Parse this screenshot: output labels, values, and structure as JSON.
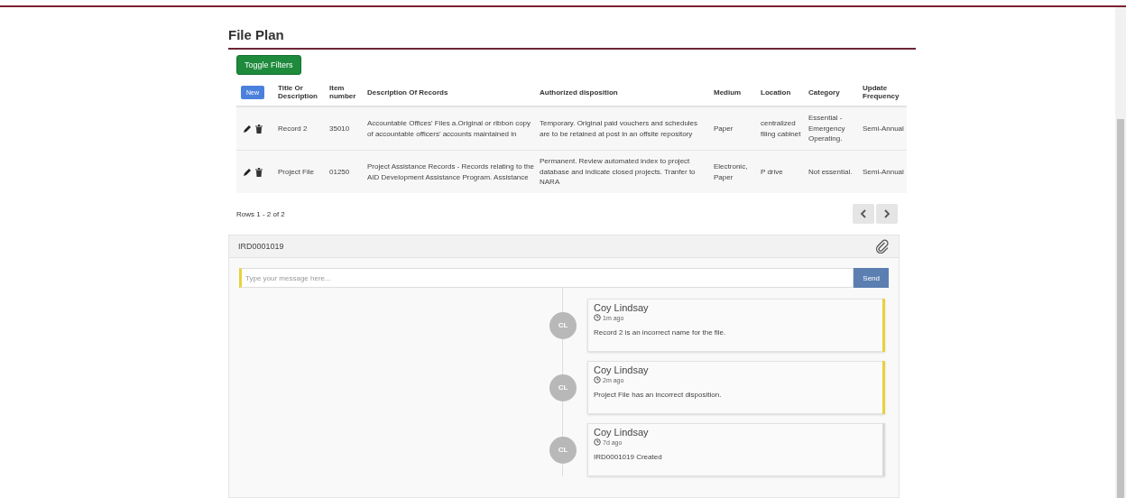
{
  "page": {
    "title": "File Plan"
  },
  "toolbar": {
    "toggle_filters": "Toggle Filters"
  },
  "table": {
    "new_button": "New",
    "columns": [
      "Title Or Description",
      "Item number",
      "Description Of Records",
      "Authorized disposition",
      "Medium",
      "Location",
      "Category",
      "Update Frequency"
    ],
    "rows": [
      {
        "cells": [
          "Record 2",
          "35010",
          "Accountable Offices' Files a.Original or ribbon copy of accountable officers' accounts maintained in",
          "Temporary. Original paid vouchers and schedules are to be retained at post in an offsite repository",
          "Paper",
          "centralized filing cabinet",
          "Essential - Emergency Operating.",
          "Semi-Annual"
        ]
      },
      {
        "cells": [
          "Project File",
          "01250",
          "Project Assistance Records - Records relating to the AID Development Assistance Program. Assistance",
          "Permanent. Review automated index to project database and indicate closed projects. Tranfer to NARA",
          "Electronic, Paper",
          "P drive",
          "Not essential.",
          "Semi-Annual"
        ]
      }
    ],
    "row_count": "Rows 1 - 2 of 2"
  },
  "comments_panel": {
    "title": "IRD0001019",
    "input": {
      "placeholder": "Type your message here..."
    },
    "send_button": "Send",
    "comments": [
      {
        "initials": "CL",
        "author": "Coy Lindsay",
        "time": "1m ago",
        "text": "Record 2 is an incorrect name for the file.",
        "highlighted": true
      },
      {
        "initials": "CL",
        "author": "Coy Lindsay",
        "time": "2m ago",
        "text": "Project File has an incorrect disposition.",
        "highlighted": true
      },
      {
        "initials": "CL",
        "author": "Coy Lindsay",
        "time": "7d ago",
        "text": "IRD0001019 Created",
        "highlighted": false
      }
    ]
  }
}
